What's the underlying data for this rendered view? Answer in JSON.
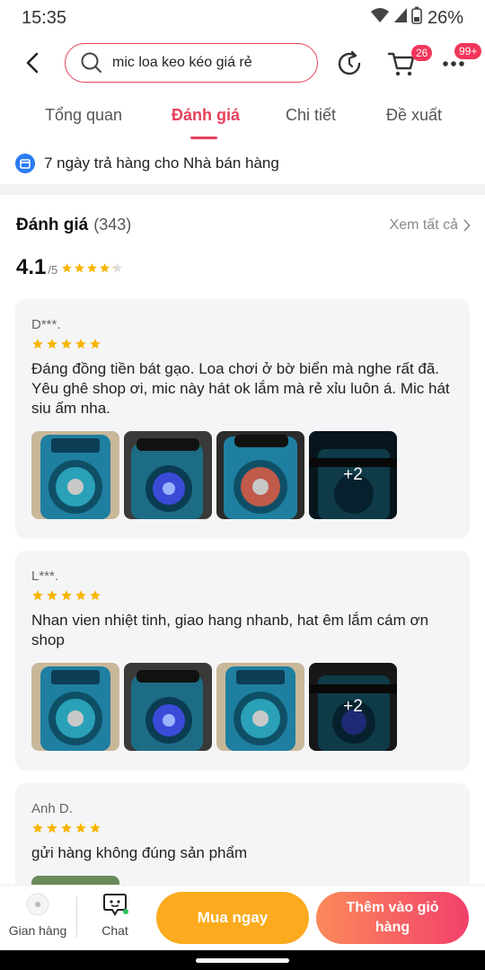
{
  "status": {
    "time": "15:35",
    "battery": "26%"
  },
  "search": {
    "query": "mic loa keo kéo giá rẻ"
  },
  "header": {
    "cart_badge": "26",
    "more_badge": "99+"
  },
  "tabs": [
    {
      "label": "Tổng quan"
    },
    {
      "label": "Đánh giá"
    },
    {
      "label": "Chi tiết"
    },
    {
      "label": "Đề xuất"
    }
  ],
  "policy": {
    "text": "7 ngày trả hàng cho Nhà bán hàng"
  },
  "rating": {
    "title": "Đánh giá",
    "count": "(343)",
    "see_all": "Xem tất cả",
    "score": "4.1",
    "score_max": "/5"
  },
  "reviews": [
    {
      "name": "D***.",
      "stars": 5,
      "text": "Đáng đồng tiền bát gạo. Loa chơi ở bờ biển mà nghe rất đã. Yêu ghê shop ơi, mic này hát ok lắm mà rẻ xỉu luôn á. Mic hát siu ấm nha.",
      "more_photos": "+2"
    },
    {
      "name": "L***.",
      "stars": 5,
      "text": "Nhan vien nhiệt tinh, giao hang nhanb, hat êm lắm cám ơn shop",
      "more_photos": "+2"
    },
    {
      "name": "Anh D.",
      "stars": 5,
      "text": "gửi hàng không đúng sản phẩm"
    }
  ],
  "bottom": {
    "store_label": "Gian hàng",
    "chat_label": "Chat",
    "buy_label": "Mua ngay",
    "cart_label": "Thêm vào giỏ hàng"
  },
  "colors": {
    "accent": "#e5415a",
    "star": "#f7b500",
    "buy": "#fbab1d",
    "cart_start": "#fb8a5a",
    "cart_end": "#f2406a"
  }
}
